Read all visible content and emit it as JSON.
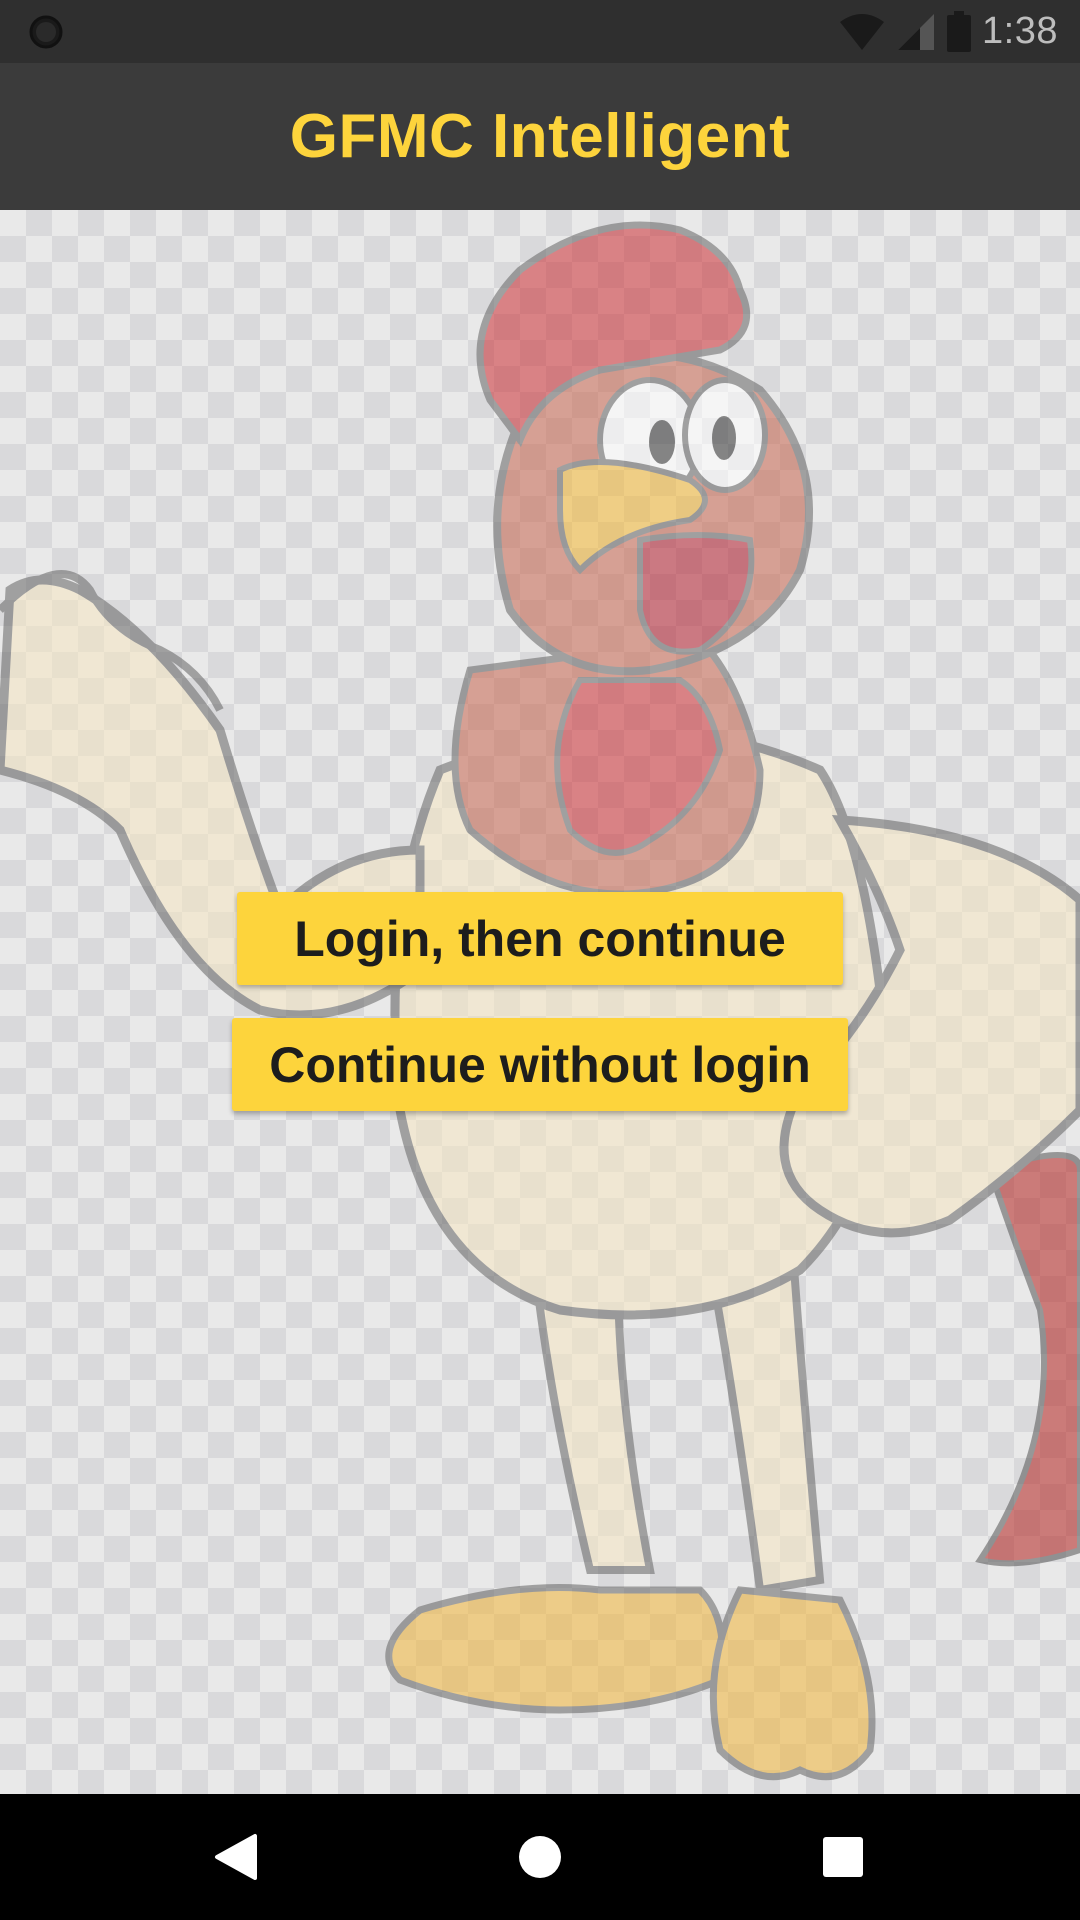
{
  "status_bar": {
    "time": "1:38",
    "icons": [
      "notification-circle-icon",
      "wifi-icon",
      "signal-icon",
      "battery-icon"
    ]
  },
  "app_bar": {
    "title": "GFMC Intelligent"
  },
  "main": {
    "background_image": "rooster-mascot",
    "buttons": {
      "login_label": "Login, then continue",
      "continue_label": "Continue without login"
    }
  },
  "nav_bar": {
    "icons": [
      "back-icon",
      "home-icon",
      "recents-icon"
    ]
  },
  "colors": {
    "accent": "#fdd43c",
    "status_bar": "#2f2f2f",
    "app_bar": "#3b3b3b",
    "nav_bar": "#000000"
  }
}
